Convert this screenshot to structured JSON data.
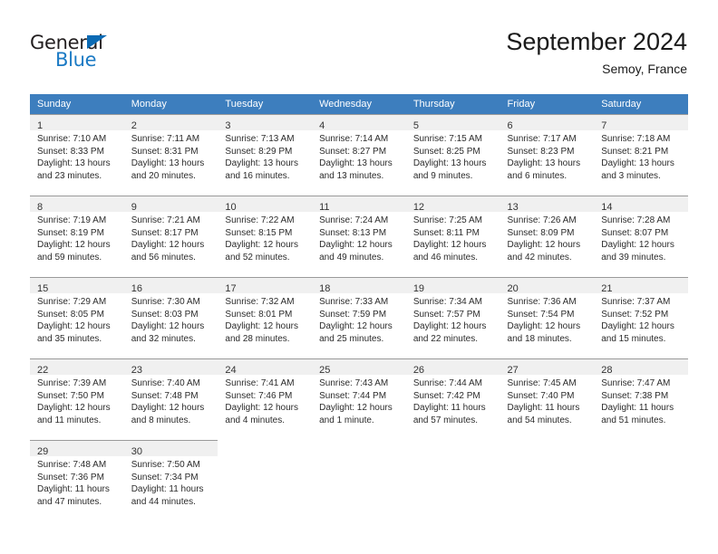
{
  "brand": {
    "name_top": "General",
    "name_bottom": "Blue",
    "accent_color": "#1b7ac4",
    "triangle_color": "#0a6ab4"
  },
  "header": {
    "month_title": "September 2024",
    "location": "Semoy, France"
  },
  "theme": {
    "header_row_bg": "#3d7ebe",
    "daynum_band_bg": "#f0f0f0",
    "grid_line": "#9a9a9a",
    "page_bg": "#ffffff",
    "text": "#2b2b2b"
  },
  "weekdays": [
    "Sunday",
    "Monday",
    "Tuesday",
    "Wednesday",
    "Thursday",
    "Friday",
    "Saturday"
  ],
  "weeks": [
    [
      {
        "day": "1",
        "sunrise": "Sunrise: 7:10 AM",
        "sunset": "Sunset: 8:33 PM",
        "daylight_1": "Daylight: 13 hours",
        "daylight_2": "and 23 minutes."
      },
      {
        "day": "2",
        "sunrise": "Sunrise: 7:11 AM",
        "sunset": "Sunset: 8:31 PM",
        "daylight_1": "Daylight: 13 hours",
        "daylight_2": "and 20 minutes."
      },
      {
        "day": "3",
        "sunrise": "Sunrise: 7:13 AM",
        "sunset": "Sunset: 8:29 PM",
        "daylight_1": "Daylight: 13 hours",
        "daylight_2": "and 16 minutes."
      },
      {
        "day": "4",
        "sunrise": "Sunrise: 7:14 AM",
        "sunset": "Sunset: 8:27 PM",
        "daylight_1": "Daylight: 13 hours",
        "daylight_2": "and 13 minutes."
      },
      {
        "day": "5",
        "sunrise": "Sunrise: 7:15 AM",
        "sunset": "Sunset: 8:25 PM",
        "daylight_1": "Daylight: 13 hours",
        "daylight_2": "and 9 minutes."
      },
      {
        "day": "6",
        "sunrise": "Sunrise: 7:17 AM",
        "sunset": "Sunset: 8:23 PM",
        "daylight_1": "Daylight: 13 hours",
        "daylight_2": "and 6 minutes."
      },
      {
        "day": "7",
        "sunrise": "Sunrise: 7:18 AM",
        "sunset": "Sunset: 8:21 PM",
        "daylight_1": "Daylight: 13 hours",
        "daylight_2": "and 3 minutes."
      }
    ],
    [
      {
        "day": "8",
        "sunrise": "Sunrise: 7:19 AM",
        "sunset": "Sunset: 8:19 PM",
        "daylight_1": "Daylight: 12 hours",
        "daylight_2": "and 59 minutes."
      },
      {
        "day": "9",
        "sunrise": "Sunrise: 7:21 AM",
        "sunset": "Sunset: 8:17 PM",
        "daylight_1": "Daylight: 12 hours",
        "daylight_2": "and 56 minutes."
      },
      {
        "day": "10",
        "sunrise": "Sunrise: 7:22 AM",
        "sunset": "Sunset: 8:15 PM",
        "daylight_1": "Daylight: 12 hours",
        "daylight_2": "and 52 minutes."
      },
      {
        "day": "11",
        "sunrise": "Sunrise: 7:24 AM",
        "sunset": "Sunset: 8:13 PM",
        "daylight_1": "Daylight: 12 hours",
        "daylight_2": "and 49 minutes."
      },
      {
        "day": "12",
        "sunrise": "Sunrise: 7:25 AM",
        "sunset": "Sunset: 8:11 PM",
        "daylight_1": "Daylight: 12 hours",
        "daylight_2": "and 46 minutes."
      },
      {
        "day": "13",
        "sunrise": "Sunrise: 7:26 AM",
        "sunset": "Sunset: 8:09 PM",
        "daylight_1": "Daylight: 12 hours",
        "daylight_2": "and 42 minutes."
      },
      {
        "day": "14",
        "sunrise": "Sunrise: 7:28 AM",
        "sunset": "Sunset: 8:07 PM",
        "daylight_1": "Daylight: 12 hours",
        "daylight_2": "and 39 minutes."
      }
    ],
    [
      {
        "day": "15",
        "sunrise": "Sunrise: 7:29 AM",
        "sunset": "Sunset: 8:05 PM",
        "daylight_1": "Daylight: 12 hours",
        "daylight_2": "and 35 minutes."
      },
      {
        "day": "16",
        "sunrise": "Sunrise: 7:30 AM",
        "sunset": "Sunset: 8:03 PM",
        "daylight_1": "Daylight: 12 hours",
        "daylight_2": "and 32 minutes."
      },
      {
        "day": "17",
        "sunrise": "Sunrise: 7:32 AM",
        "sunset": "Sunset: 8:01 PM",
        "daylight_1": "Daylight: 12 hours",
        "daylight_2": "and 28 minutes."
      },
      {
        "day": "18",
        "sunrise": "Sunrise: 7:33 AM",
        "sunset": "Sunset: 7:59 PM",
        "daylight_1": "Daylight: 12 hours",
        "daylight_2": "and 25 minutes."
      },
      {
        "day": "19",
        "sunrise": "Sunrise: 7:34 AM",
        "sunset": "Sunset: 7:57 PM",
        "daylight_1": "Daylight: 12 hours",
        "daylight_2": "and 22 minutes."
      },
      {
        "day": "20",
        "sunrise": "Sunrise: 7:36 AM",
        "sunset": "Sunset: 7:54 PM",
        "daylight_1": "Daylight: 12 hours",
        "daylight_2": "and 18 minutes."
      },
      {
        "day": "21",
        "sunrise": "Sunrise: 7:37 AM",
        "sunset": "Sunset: 7:52 PM",
        "daylight_1": "Daylight: 12 hours",
        "daylight_2": "and 15 minutes."
      }
    ],
    [
      {
        "day": "22",
        "sunrise": "Sunrise: 7:39 AM",
        "sunset": "Sunset: 7:50 PM",
        "daylight_1": "Daylight: 12 hours",
        "daylight_2": "and 11 minutes."
      },
      {
        "day": "23",
        "sunrise": "Sunrise: 7:40 AM",
        "sunset": "Sunset: 7:48 PM",
        "daylight_1": "Daylight: 12 hours",
        "daylight_2": "and 8 minutes."
      },
      {
        "day": "24",
        "sunrise": "Sunrise: 7:41 AM",
        "sunset": "Sunset: 7:46 PM",
        "daylight_1": "Daylight: 12 hours",
        "daylight_2": "and 4 minutes."
      },
      {
        "day": "25",
        "sunrise": "Sunrise: 7:43 AM",
        "sunset": "Sunset: 7:44 PM",
        "daylight_1": "Daylight: 12 hours",
        "daylight_2": "and 1 minute."
      },
      {
        "day": "26",
        "sunrise": "Sunrise: 7:44 AM",
        "sunset": "Sunset: 7:42 PM",
        "daylight_1": "Daylight: 11 hours",
        "daylight_2": "and 57 minutes."
      },
      {
        "day": "27",
        "sunrise": "Sunrise: 7:45 AM",
        "sunset": "Sunset: 7:40 PM",
        "daylight_1": "Daylight: 11 hours",
        "daylight_2": "and 54 minutes."
      },
      {
        "day": "28",
        "sunrise": "Sunrise: 7:47 AM",
        "sunset": "Sunset: 7:38 PM",
        "daylight_1": "Daylight: 11 hours",
        "daylight_2": "and 51 minutes."
      }
    ],
    [
      {
        "day": "29",
        "sunrise": "Sunrise: 7:48 AM",
        "sunset": "Sunset: 7:36 PM",
        "daylight_1": "Daylight: 11 hours",
        "daylight_2": "and 47 minutes."
      },
      {
        "day": "30",
        "sunrise": "Sunrise: 7:50 AM",
        "sunset": "Sunset: 7:34 PM",
        "daylight_1": "Daylight: 11 hours",
        "daylight_2": "and 44 minutes."
      },
      {
        "day": "",
        "sunrise": "",
        "sunset": "",
        "daylight_1": "",
        "daylight_2": ""
      },
      {
        "day": "",
        "sunrise": "",
        "sunset": "",
        "daylight_1": "",
        "daylight_2": ""
      },
      {
        "day": "",
        "sunrise": "",
        "sunset": "",
        "daylight_1": "",
        "daylight_2": ""
      },
      {
        "day": "",
        "sunrise": "",
        "sunset": "",
        "daylight_1": "",
        "daylight_2": ""
      },
      {
        "day": "",
        "sunrise": "",
        "sunset": "",
        "daylight_1": "",
        "daylight_2": ""
      }
    ]
  ]
}
